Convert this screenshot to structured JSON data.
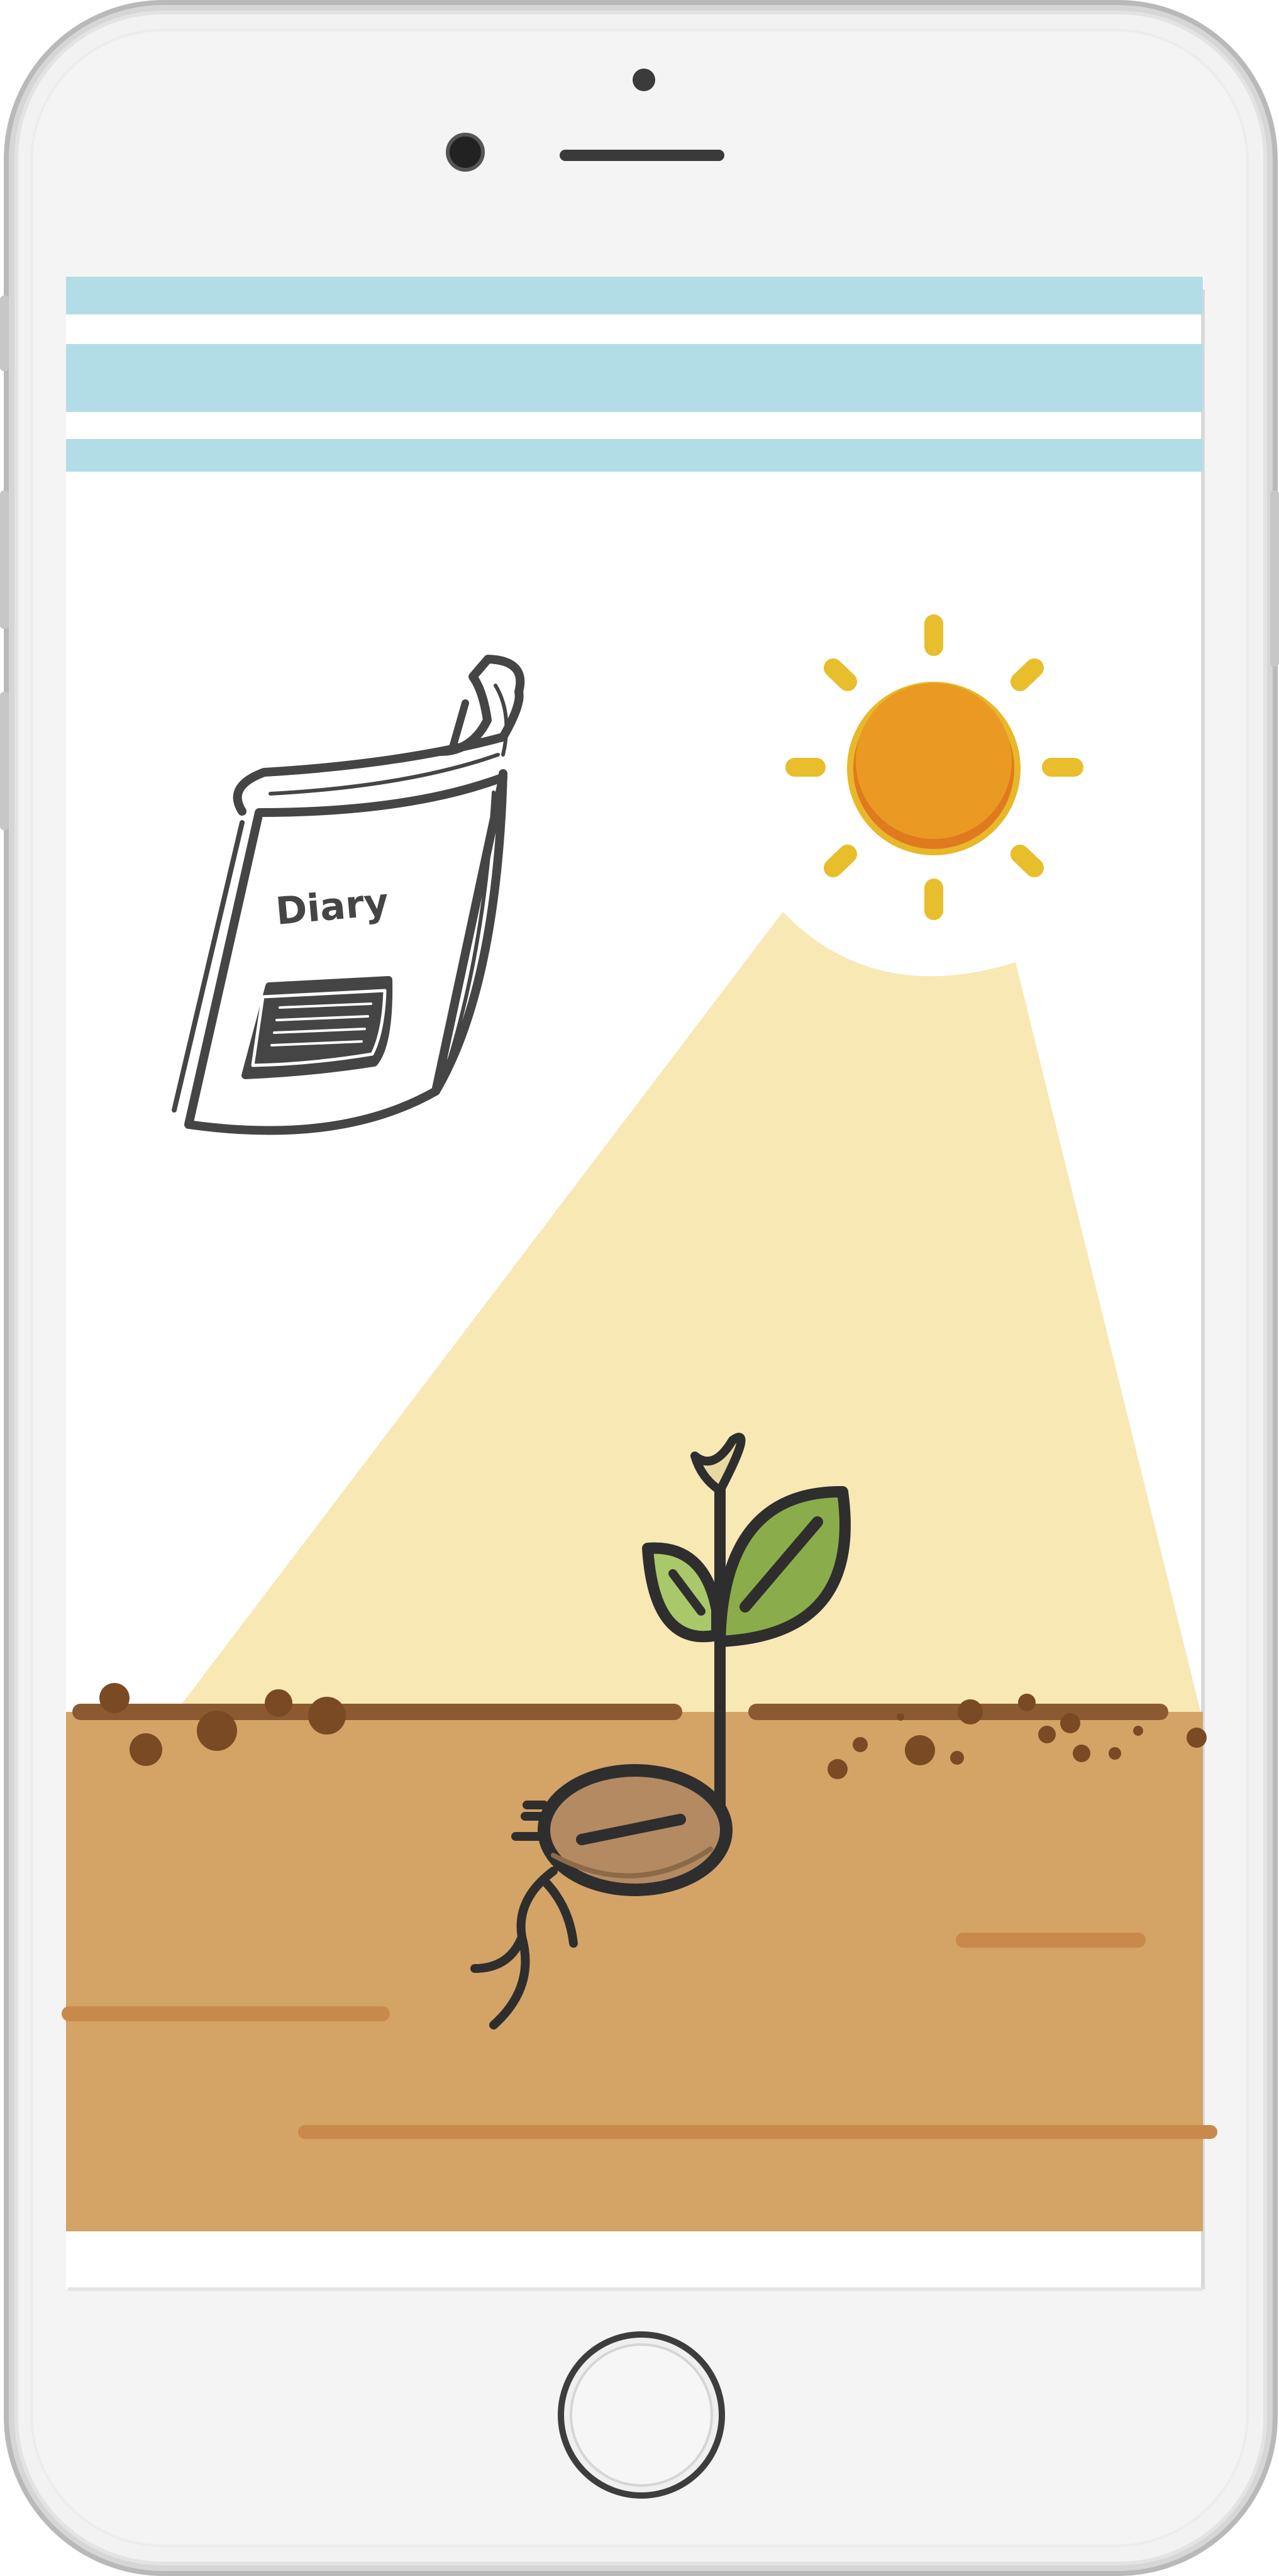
{
  "diary": {
    "cover_title": "Diary"
  },
  "colors": {
    "phone_body": "#f2f2f2",
    "phone_frame": "#c9c9c9",
    "stripe": "#b3dde6",
    "sun_core": "#ea9a22",
    "sun_ray": "#e8be2c",
    "sunbeam": "#f8e8b4",
    "soil": "#d4a366",
    "soil_line": "#8c5a30",
    "leaf": "#8bac4a",
    "seed": "#b38a62",
    "outline": "#3a3a3a"
  },
  "icons": [
    "phone-frame",
    "front-camera-icon",
    "earpiece-speaker",
    "home-button",
    "diary-icon",
    "sun-icon",
    "sprout-icon",
    "seed-icon"
  ]
}
